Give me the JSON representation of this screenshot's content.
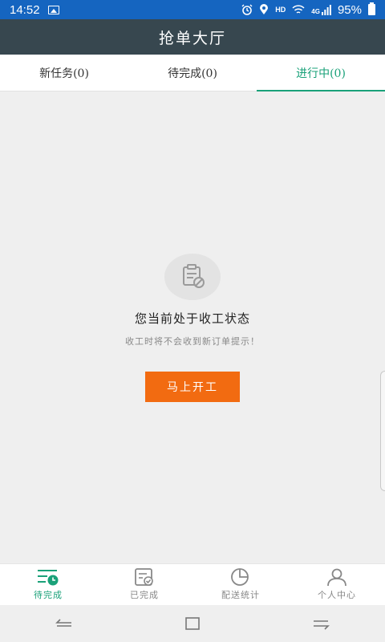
{
  "status_bar": {
    "time": "14:52",
    "hd": "HD",
    "signal": "4G",
    "battery": "95%"
  },
  "title": "抢单大厅",
  "tabs": [
    {
      "label": "新任务(0)"
    },
    {
      "label": "待完成(0)"
    },
    {
      "label": "进行中(0)"
    }
  ],
  "empty_state": {
    "title": "您当前处于收工状态",
    "subtitle": "收工时将不会收到新订单提示！",
    "button_label": "马上开工"
  },
  "bottom_nav": [
    {
      "label": "待完成",
      "icon": "list-clock-icon"
    },
    {
      "label": "已完成",
      "icon": "checked-doc-icon"
    },
    {
      "label": "配送统计",
      "icon": "pie-chart-icon"
    },
    {
      "label": "个人中心",
      "icon": "user-icon"
    }
  ],
  "colors": {
    "status_bar": "#1565c0",
    "title_bar": "#37474f",
    "accent": "#1aa179",
    "button": "#f26b11"
  }
}
